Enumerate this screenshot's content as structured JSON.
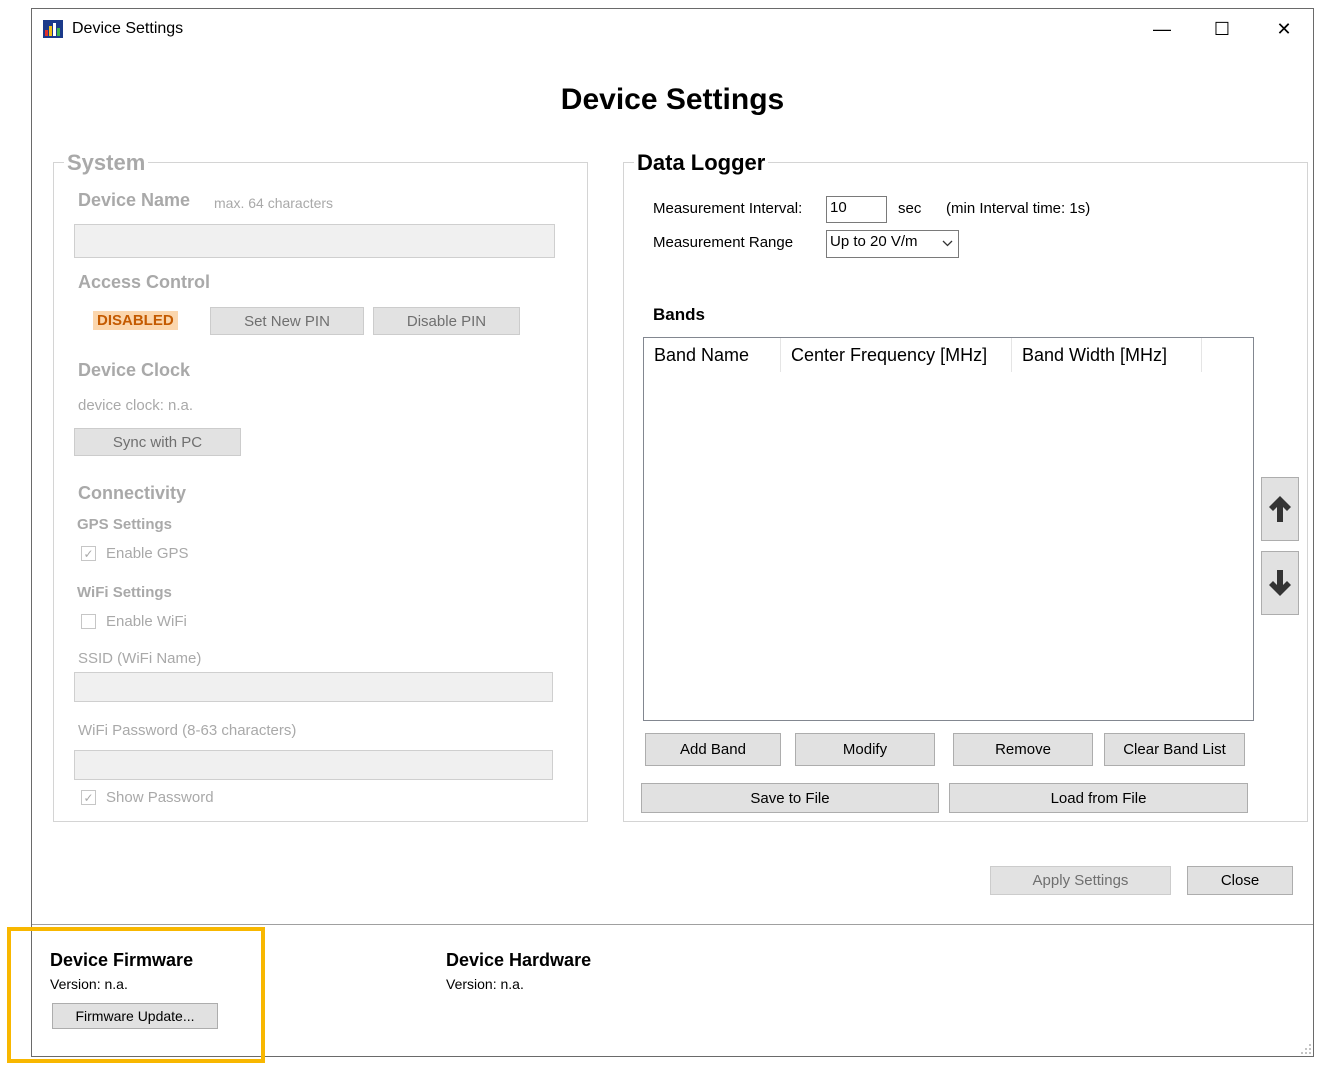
{
  "window": {
    "title": "Device Settings",
    "heading": "Device Settings",
    "minimize_glyph": "—",
    "maximize_glyph": "☐",
    "close_glyph": "✕"
  },
  "system": {
    "legend": "System",
    "device_name_label": "Device Name",
    "device_name_hint": "max. 64 characters",
    "device_name_value": "",
    "access_control_label": "Access Control",
    "access_status": "DISABLED",
    "set_pin_label": "Set New PIN",
    "disable_pin_label": "Disable PIN",
    "device_clock_label": "Device Clock",
    "device_clock_value": "device clock: n.a.",
    "sync_label": "Sync with PC",
    "connectivity_label": "Connectivity",
    "gps_settings_label": "GPS Settings",
    "enable_gps_label": "Enable GPS",
    "enable_gps_checked": true,
    "wifi_settings_label": "WiFi Settings",
    "enable_wifi_label": "Enable WiFi",
    "enable_wifi_checked": false,
    "ssid_label": "SSID (WiFi Name)",
    "ssid_value": "",
    "password_label": "WiFi Password (8-63 characters)",
    "password_value": "",
    "show_password_label": "Show Password",
    "show_password_checked": true
  },
  "data_logger": {
    "legend": "Data Logger",
    "interval_label": "Measurement Interval:",
    "interval_value": "10",
    "interval_unit": "sec",
    "interval_hint": "(min Interval time: 1s)",
    "range_label": "Measurement Range",
    "range_value": "Up to 20 V/m",
    "bands_label": "Bands",
    "columns": [
      "Band Name",
      "Center Frequency [MHz]",
      "Band Width [MHz]"
    ],
    "rows": [],
    "add_band_label": "Add Band",
    "modify_label": "Modify",
    "remove_label": "Remove",
    "clear_label": "Clear Band List",
    "save_label": "Save to File",
    "load_label": "Load from File"
  },
  "actions": {
    "apply_label": "Apply Settings",
    "close_label": "Close"
  },
  "footer": {
    "firmware_title": "Device Firmware",
    "firmware_version": "Version: n.a.",
    "firmware_update_label": "Firmware Update...",
    "hardware_title": "Device Hardware",
    "hardware_version": "Version: n.a."
  },
  "colors": {
    "highlight": "#f8b700",
    "badge_bg": "#fbd6ad",
    "badge_text": "#c45a00"
  }
}
